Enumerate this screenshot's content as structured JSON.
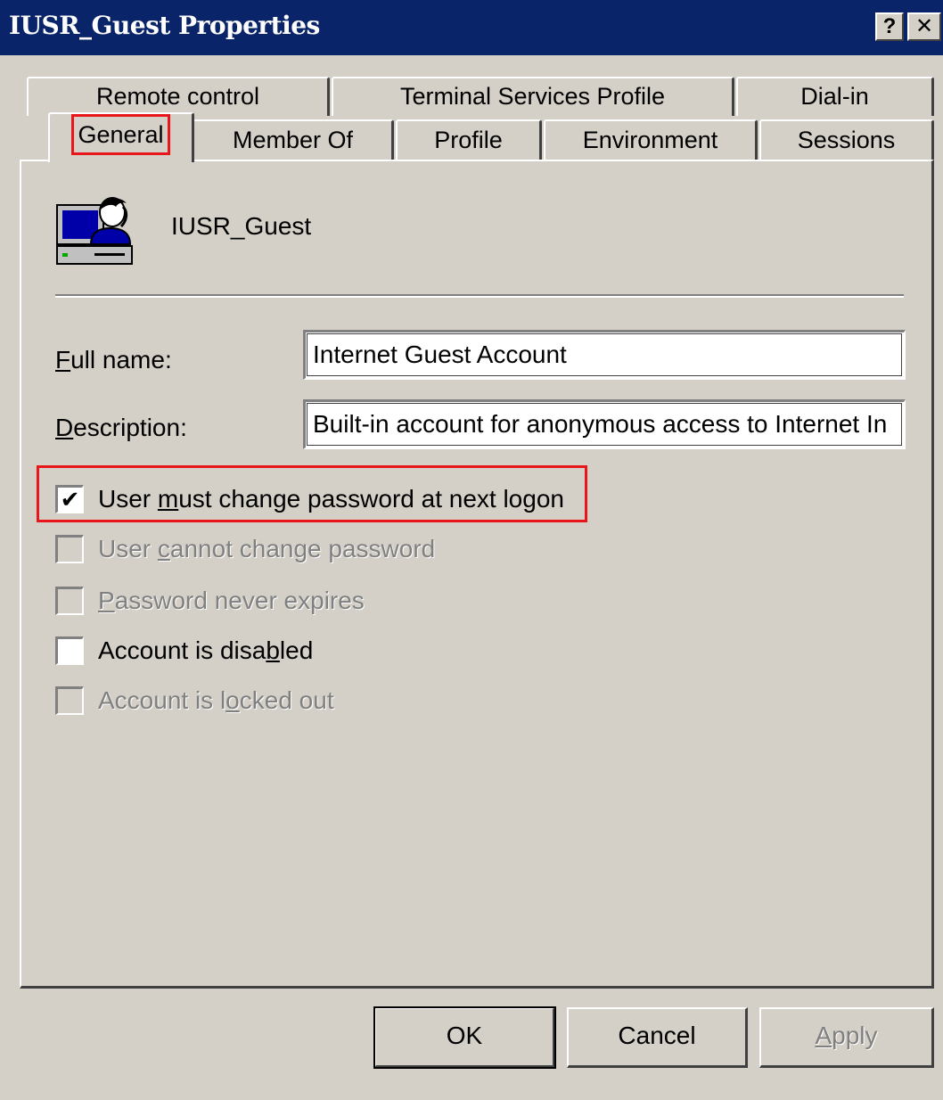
{
  "window": {
    "title": "IUSR_Guest Properties",
    "help_glyph": "?",
    "close_glyph": "✕"
  },
  "tabs": {
    "row1": [
      "Remote control",
      "Terminal Services Profile",
      "Dial-in"
    ],
    "row2": [
      "General",
      "Member Of",
      "Profile",
      "Environment",
      "Sessions"
    ],
    "selected": "General"
  },
  "user": {
    "icon": "user-computer-icon",
    "name": "IUSR_Guest"
  },
  "fields": {
    "full_name_label_mnemonic": "F",
    "full_name_label_rest": "ull name:",
    "full_name_value": "Internet Guest Account",
    "description_label_mnemonic": "D",
    "description_label_rest": "escription:",
    "description_value": "Built-in account for anonymous access to Internet In"
  },
  "checkboxes": {
    "must_change": {
      "pre": "User ",
      "mnemonic": "m",
      "post": "ust change password at next logon",
      "checked": true,
      "enabled": true
    },
    "cannot_change": {
      "pre": "User ",
      "mnemonic": "c",
      "post": "annot change password",
      "checked": false,
      "enabled": false
    },
    "never_expires": {
      "pre": "",
      "mnemonic": "P",
      "post": "assword never expires",
      "checked": false,
      "enabled": false
    },
    "disabled": {
      "pre": "Account is disa",
      "mnemonic": "b",
      "post": "led",
      "checked": false,
      "enabled": true
    },
    "locked": {
      "pre": "Account is l",
      "mnemonic": "o",
      "post": "cked out",
      "checked": false,
      "enabled": false
    }
  },
  "buttons": {
    "ok": "OK",
    "cancel": "Cancel",
    "apply_mnemonic": "A",
    "apply_rest": "pply"
  },
  "colors": {
    "title_bar": "#0a246a",
    "face": "#d4d0c8",
    "highlight_annotation": "#e8161a"
  }
}
